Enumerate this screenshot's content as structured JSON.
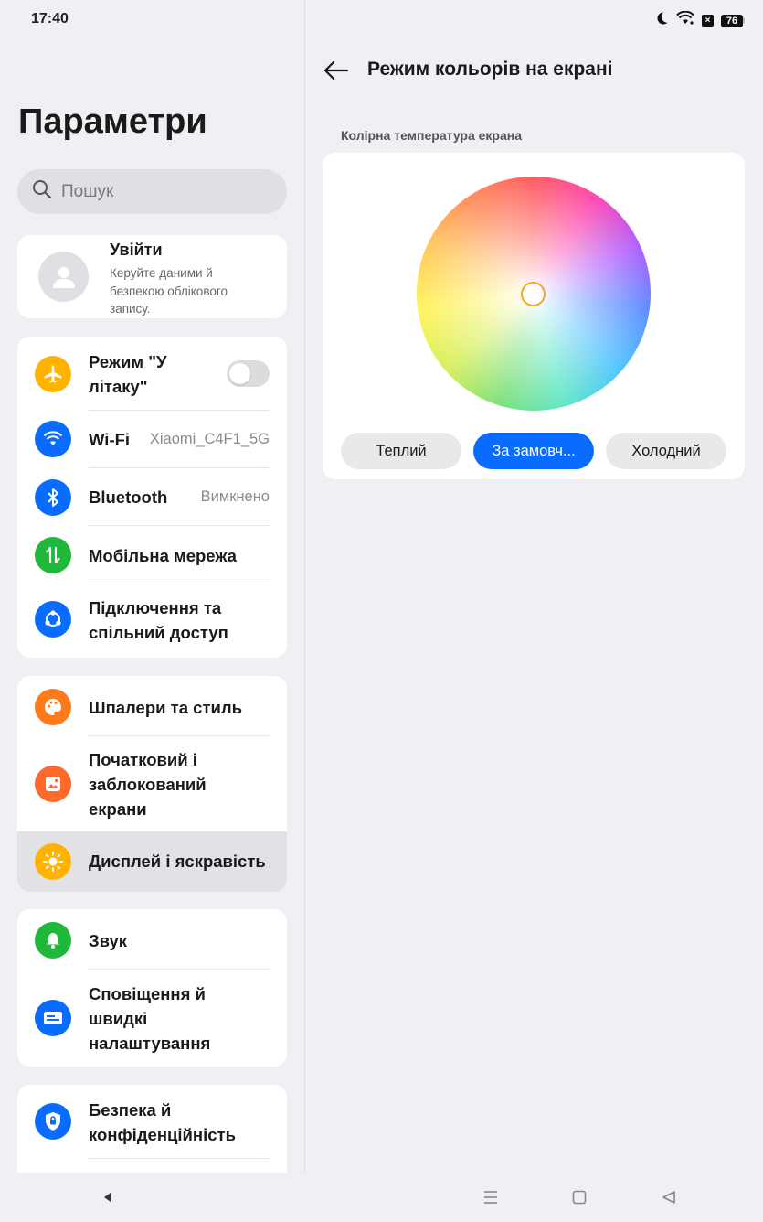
{
  "status": {
    "time": "17:40",
    "battery": "76",
    "moon_icon": "moon-icon",
    "wifi_icon": "wifi-icon"
  },
  "sidebar": {
    "title": "Параметри",
    "search_placeholder": "Пошук",
    "account": {
      "title": "Увійти",
      "subtitle": "Керуйте даними й безпекою облікового запису."
    },
    "network": [
      {
        "label": "Режим \"У літаку\"",
        "icon": "airplane-icon",
        "color": "#ffb300",
        "toggle": false
      },
      {
        "label": "Wi-Fi",
        "value": "Xiaomi_C4F1_5G",
        "icon": "wifi-icon",
        "color": "#0a6cff"
      },
      {
        "label": "Bluetooth",
        "value": "Вимкнено",
        "icon": "bluetooth-icon",
        "color": "#0a6cff"
      },
      {
        "label": "Мобільна мережа",
        "icon": "mobile-data-icon",
        "color": "#1fb83a"
      },
      {
        "label": "Підключення та спільний доступ",
        "icon": "share-icon",
        "color": "#0a6cff"
      }
    ],
    "personalize": [
      {
        "label": "Шпалери та стиль",
        "icon": "palette-icon",
        "color": "#ff7a1a"
      },
      {
        "label": "Початковий і заблокований екрани",
        "icon": "lockscreen-icon",
        "color": "#ff6a2a"
      },
      {
        "label": "Дисплей і яскравість",
        "icon": "brightness-icon",
        "color": "#ffb300",
        "selected": true
      }
    ],
    "sound": [
      {
        "label": "Звук",
        "icon": "bell-icon",
        "color": "#1fb83a"
      },
      {
        "label": "Сповіщення й швидкі налаштування",
        "icon": "notification-icon",
        "color": "#0a6cff"
      }
    ],
    "security": [
      {
        "label": "Безпека й конфіденційність",
        "icon": "shield-icon",
        "color": "#0a6cff"
      }
    ]
  },
  "detail": {
    "title": "Режим кольорів на екрані",
    "section_label": "Колірна температура екрана",
    "options": [
      "Теплий",
      "За замовч...",
      "Холодний"
    ],
    "selected_option": "За замовч...",
    "accent": "#0a6cff"
  }
}
